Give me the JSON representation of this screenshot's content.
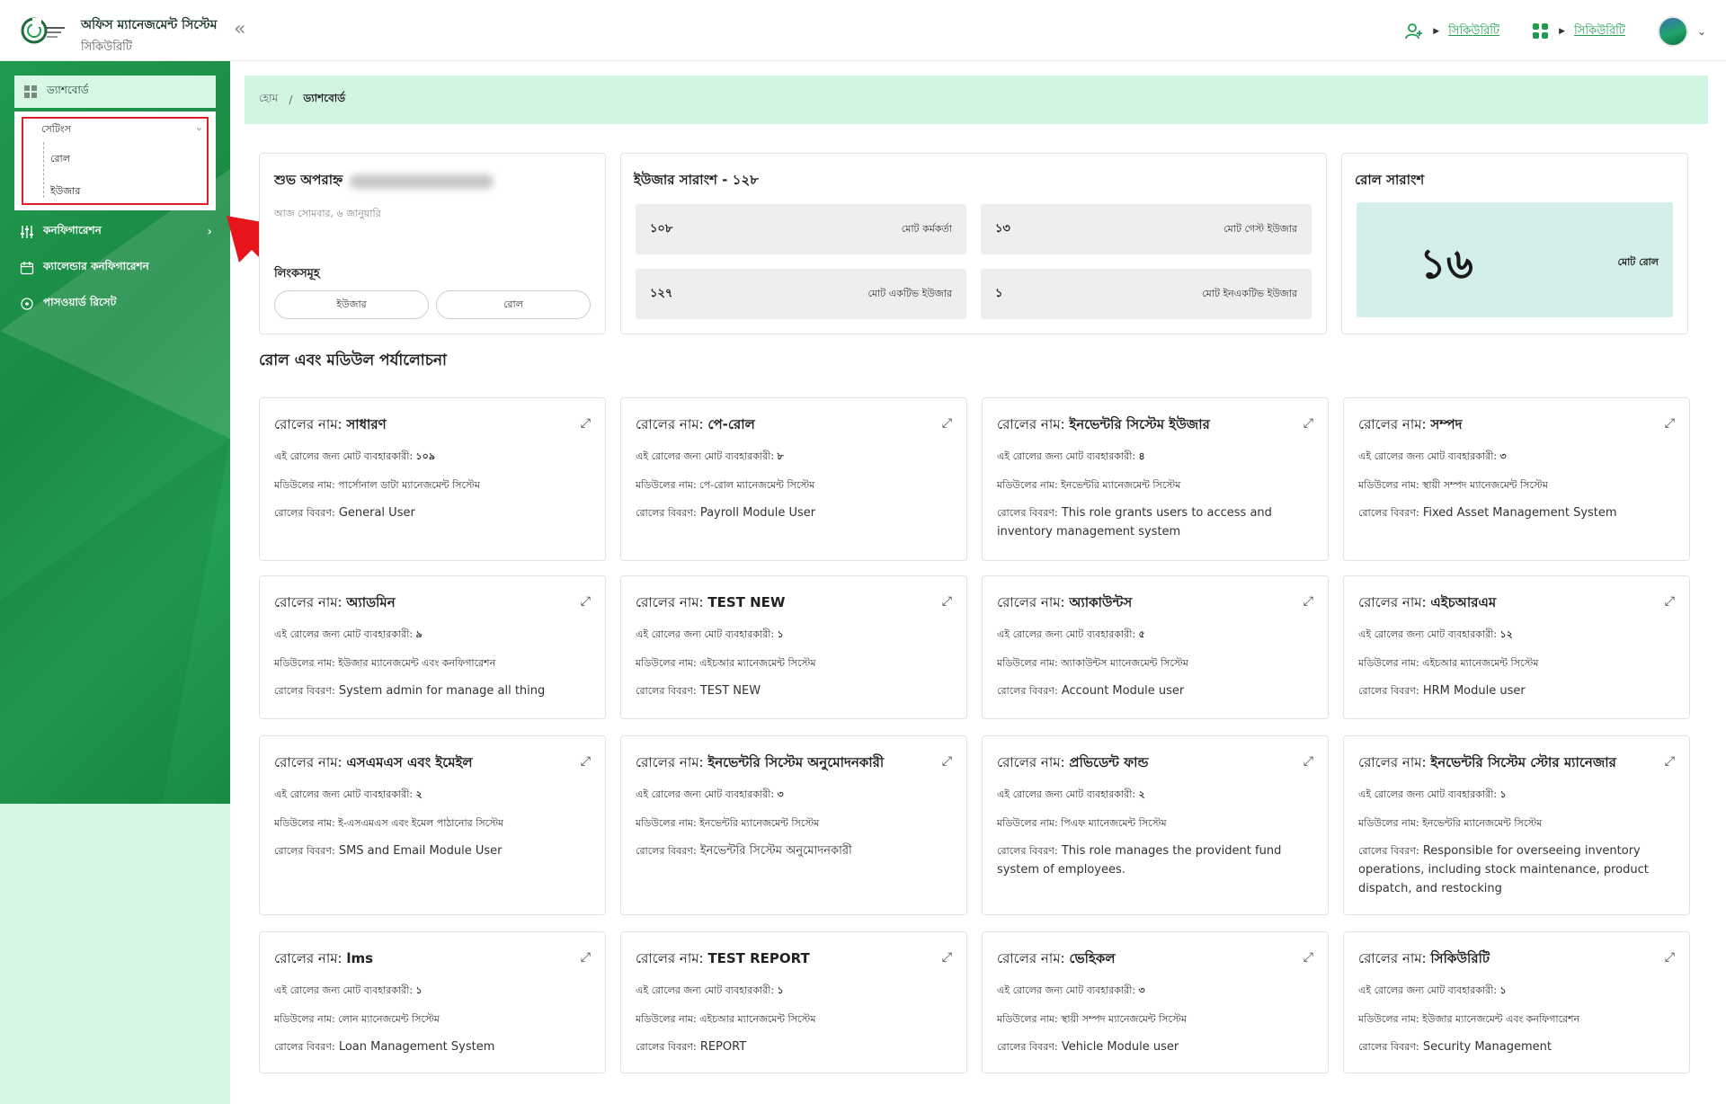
{
  "header": {
    "title": "অফিস ম্যানেজমেন্ট সিস্টেম",
    "subtitle": "সিকিউরিটি",
    "nav1": "সিকিউরিটি",
    "nav2": "সিকিউরিটি",
    "collapse_icon": "double-chevron-left-icon"
  },
  "sidebar": {
    "dashboard": "ড্যাশবোর্ড",
    "settings": "সেটিংস",
    "settings_sub": [
      "রোল",
      "ইউজার"
    ],
    "configuration": "কনফিগারেশন",
    "calendar_configuration": "ক্যালেন্ডার কনফিগারেশন",
    "password_reset": "পাসওয়ার্ড রিসেট"
  },
  "breadcrumb": {
    "home": "হোম",
    "separator": "/",
    "current": "ড্যাশবোর্ড"
  },
  "greeting": {
    "title": "শুভ অপরাহ্ন",
    "date": "আজ সোমবার, ৬ জানুয়ারি",
    "quick_label": "লিংকসমূহ",
    "btn_user": "ইউজার",
    "btn_role": "রোল"
  },
  "user_summary": {
    "title": "ইউজার সারাংশ - ১২৮",
    "stats": [
      {
        "num": "১০৮",
        "label": "মোট কর্মকর্তা"
      },
      {
        "num": "১৩",
        "label": "মোট গেস্ট ইউজার"
      },
      {
        "num": "১২৭",
        "label": "মোট একটিভ ইউজার"
      },
      {
        "num": "১",
        "label": "মোট ইনএকটিভ ইউজার"
      }
    ]
  },
  "role_summary": {
    "title": "রোল সারাংশ",
    "count": "১৬",
    "label": "মোট রোল"
  },
  "section_title": "রোল এবং মডিউল পর্যালোচনা",
  "labels": {
    "role_name": "রোলের নাম:",
    "users": "এই রোলের জন্য মোট ব্যবহারকারী:",
    "module": "মডিউলের নাম:",
    "desc": "রোলের বিবরণ:"
  },
  "roles": [
    {
      "name": "সাধারণ",
      "users": "১০৯",
      "module": "পার্সোনাল ডাটা ম্যানেজমেন্ট সিস্টেম",
      "desc": "General User"
    },
    {
      "name": "পে-রোল",
      "users": "৮",
      "module": "পে-রোল ম্যানেজমেন্ট সিস্টেম",
      "desc": "Payroll Module User"
    },
    {
      "name": "ইনভেন্টরি সিস্টেম ইউজার",
      "users": "৪",
      "module": "ইনভেন্টরি ম্যানেজমেন্ট সিস্টেম",
      "desc": "This role grants users to access and inventory management system"
    },
    {
      "name": "সম্পদ",
      "users": "৩",
      "module": "স্থায়ী সম্পদ ম্যানেজমেন্ট সিস্টেম",
      "desc": "Fixed Asset Management System"
    },
    {
      "name": "অ্যাডমিন",
      "users": "৯",
      "module": "ইউজার ম্যানেজমেন্ট এবং কনফিগারেশন",
      "desc": "System admin for manage all thing"
    },
    {
      "name": "TEST NEW",
      "users": "১",
      "module": "এইচআর ম্যানেজমেন্ট সিস্টেম",
      "desc": "TEST NEW"
    },
    {
      "name": "অ্যাকাউন্টস",
      "users": "৫",
      "module": "অ্যাকাউন্টস ম্যানেজমেন্ট সিস্টেম",
      "desc": "Account Module user"
    },
    {
      "name": "এইচআরএম",
      "users": "১২",
      "module": "এইচআর ম্যানেজমেন্ট সিস্টেম",
      "desc": "HRM Module user"
    },
    {
      "name": "এসএমএস এবং ইমেইল",
      "users": "২",
      "module": "ই-এসএমএস এবং ইমেল পাঠানোর সিস্টেম",
      "desc": "SMS and Email Module User"
    },
    {
      "name": "ইনভেন্টরি সিস্টেম অনুমোদনকারী",
      "users": "৩",
      "module": "ইনভেন্টরি ম্যানেজমেন্ট সিস্টেম",
      "desc": "ইনভেন্টরি সিস্টেম অনুমোদনকারী"
    },
    {
      "name": "প্রভিডেন্ট ফান্ড",
      "users": "২",
      "module": "পিএফ ম্যানেজমেন্ট সিস্টেম",
      "desc": "This role manages the provident fund system of employees."
    },
    {
      "name": "ইনভেন্টরি সিস্টেম স্টোর ম্যানেজার",
      "users": "১",
      "module": "ইনভেন্টরি ম্যানেজমেন্ট সিস্টেম",
      "desc": "Responsible for overseeing inventory operations, including stock maintenance, product dispatch, and restocking"
    },
    {
      "name": "lms",
      "users": "১",
      "module": "লোন ম্যানেজমেন্ট সিস্টেম",
      "desc": "Loan Management System"
    },
    {
      "name": "TEST REPORT",
      "users": "১",
      "module": "এইচআর ম্যানেজমেন্ট সিস্টেম",
      "desc": "REPORT"
    },
    {
      "name": "ভেহিকল",
      "users": "৩",
      "module": "স্থায়ী সম্পদ ম্যানেজমেন্ট সিস্টেম",
      "desc": "Vehicle Module user"
    },
    {
      "name": "সিকিউরিটি",
      "users": "১",
      "module": "ইউজার ম্যানেজমেন্ট এবং কনফিগারেশন",
      "desc": "Security Management"
    }
  ],
  "colors": {
    "brand_green": "#1f9d4f",
    "mint": "#d1f5e1",
    "annotation_red": "#e01f26"
  }
}
